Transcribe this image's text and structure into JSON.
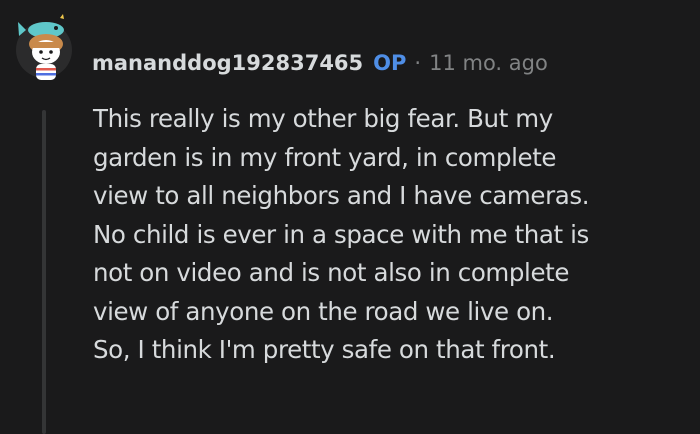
{
  "comment": {
    "author": "mananddog192837465",
    "op_badge": "OP",
    "separator": "·",
    "timestamp": "11 mo. ago",
    "avatar_icon": "snoo-avatar-icon",
    "body_lines": [
      "This really is my other big fear. But my",
      "garden is in my front yard, in complete",
      "view to all neighbors and I have cameras.",
      "No child is ever in a space with me that is",
      "not on video and is not also in complete",
      "view of anyone on the road we live on.",
      "So, I think I'm pretty safe on that front."
    ]
  },
  "colors": {
    "background": "#1a1a1b",
    "text": "#d7dadc",
    "muted": "#818384",
    "op_accent": "#4f8ee6",
    "thread_line": "#343536"
  }
}
